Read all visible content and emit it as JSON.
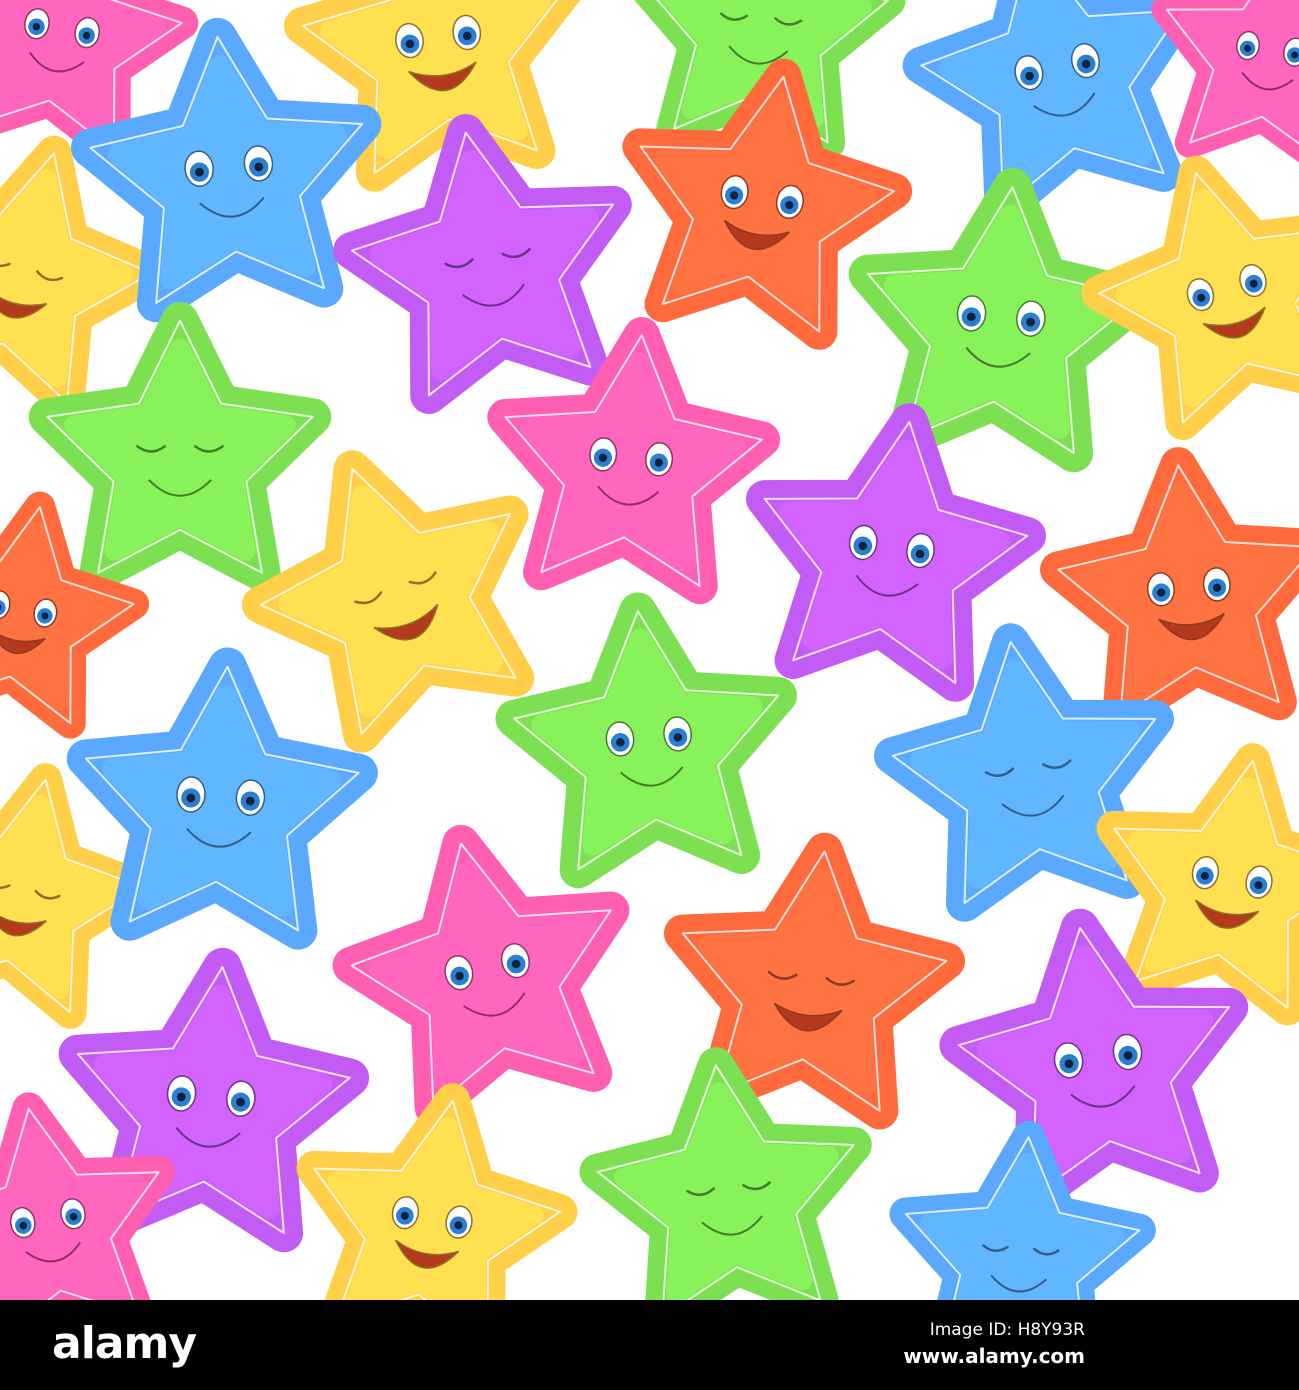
{
  "palette": {
    "blue": "#5aa9ff",
    "yellow": "#ffcf4a",
    "green": "#7de052",
    "pink": "#ff5fb0",
    "purple": "#c25cf5",
    "orange": "#ff6a3d"
  },
  "footer": {
    "logo": "alamy",
    "image_id": "Image ID: H8Y93R",
    "website": "www.alamy.com"
  }
}
